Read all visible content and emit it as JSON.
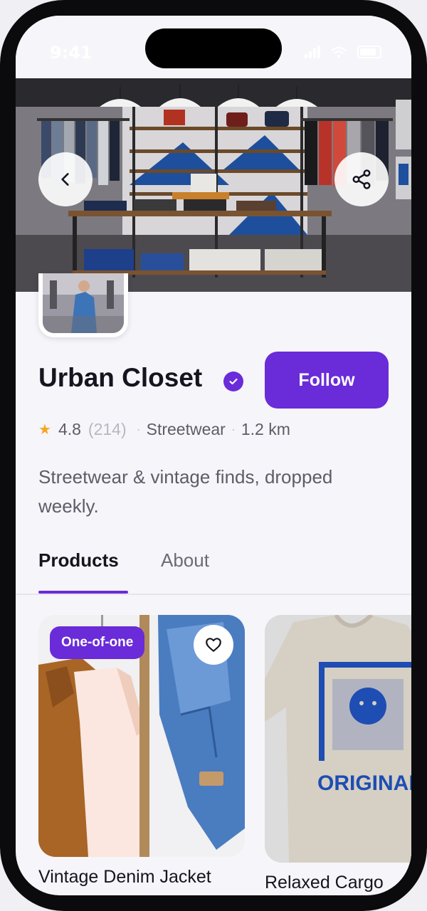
{
  "status_bar": {
    "time": "9:41"
  },
  "store": {
    "name": "Urban Closet",
    "follow_label": "Follow",
    "rating": "4.8",
    "review_count": "(214)",
    "category": "Streetwear",
    "distance": "1.2 km",
    "description": "Streetwear & vintage finds, dropped weekly."
  },
  "tabs": [
    {
      "label": "Products",
      "active": true
    },
    {
      "label": "About",
      "active": false
    }
  ],
  "products": [
    {
      "name": "Vintage Denim Jacket",
      "badge": "One-of-one"
    },
    {
      "name": "Relaxed Cargo"
    }
  ],
  "icons": {
    "back": "chevron-left-icon",
    "share": "share-icon",
    "verified": "verified-check-icon",
    "rating": "star-icon",
    "favorite": "heart-icon"
  },
  "colors": {
    "accent": "#6A2BD9",
    "star": "#F5A623",
    "text": "#16141F",
    "muted": "#5E5C68"
  }
}
